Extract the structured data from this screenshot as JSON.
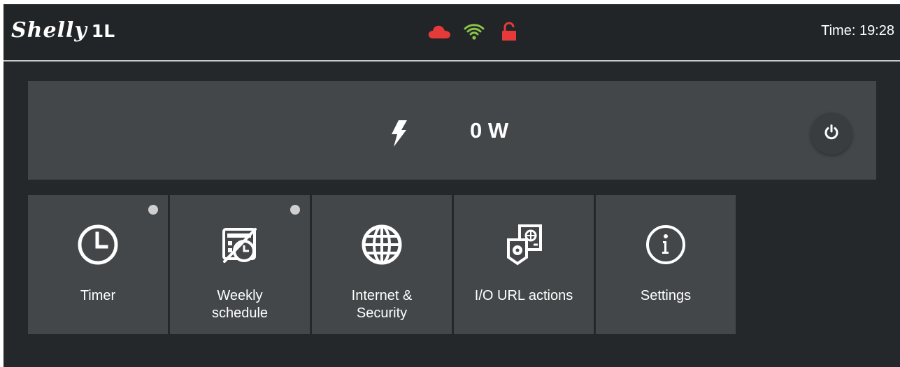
{
  "header": {
    "logo_text": "Shelly",
    "model_text": "1L",
    "status_icons": [
      {
        "name": "cloud-icon",
        "color": "#e63a3a"
      },
      {
        "name": "wifi-icon",
        "color": "#8bc34a"
      },
      {
        "name": "unlocked-icon",
        "color": "#e63a3a"
      }
    ],
    "time_text": "Time: 19:28"
  },
  "power": {
    "icon": "lightning-bolt-icon",
    "value_text": "0 W",
    "toggle_icon": "power-icon"
  },
  "tiles": [
    {
      "label": "Timer",
      "icon": "clock-icon",
      "indicator": true
    },
    {
      "label": "Weekly\nschedule",
      "icon": "calendar-disabled-icon",
      "indicator": true
    },
    {
      "label": "Internet &\nSecurity",
      "icon": "globe-icon",
      "indicator": false
    },
    {
      "label": "I/O URL actions",
      "icon": "url-actions-icon",
      "indicator": false
    },
    {
      "label": "Settings",
      "icon": "info-icon",
      "indicator": false
    }
  ],
  "colors": {
    "background": "#25282a",
    "panel": "#44474a",
    "indicator": "#cfcfcf",
    "alert": "#e63a3a",
    "ok": "#8bc34a"
  }
}
